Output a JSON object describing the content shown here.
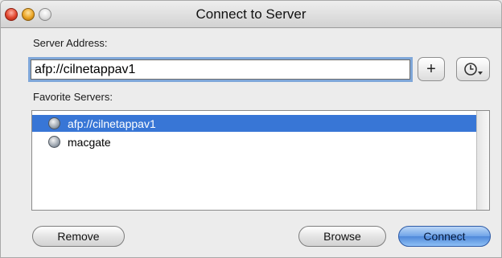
{
  "window": {
    "title": "Connect to Server",
    "controls": [
      "close",
      "minimize",
      "zoom"
    ]
  },
  "server_address": {
    "label": "Server Address:",
    "value": "afp://cilnetappav1",
    "add_button_label": "+",
    "recent_button_icon": "clock-dropdown-icon"
  },
  "favorites": {
    "label": "Favorite Servers:",
    "items": [
      {
        "label": "afp://cilnetappav1",
        "selected": true,
        "icon": "server-globe-icon"
      },
      {
        "label": "macgate",
        "selected": false,
        "icon": "server-globe-icon"
      }
    ]
  },
  "buttons": {
    "remove": "Remove",
    "browse": "Browse",
    "connect": "Connect"
  },
  "colors": {
    "selection": "#3876d6",
    "focus_ring": "#7fa7d9",
    "default_button": "#6fa4e8"
  }
}
